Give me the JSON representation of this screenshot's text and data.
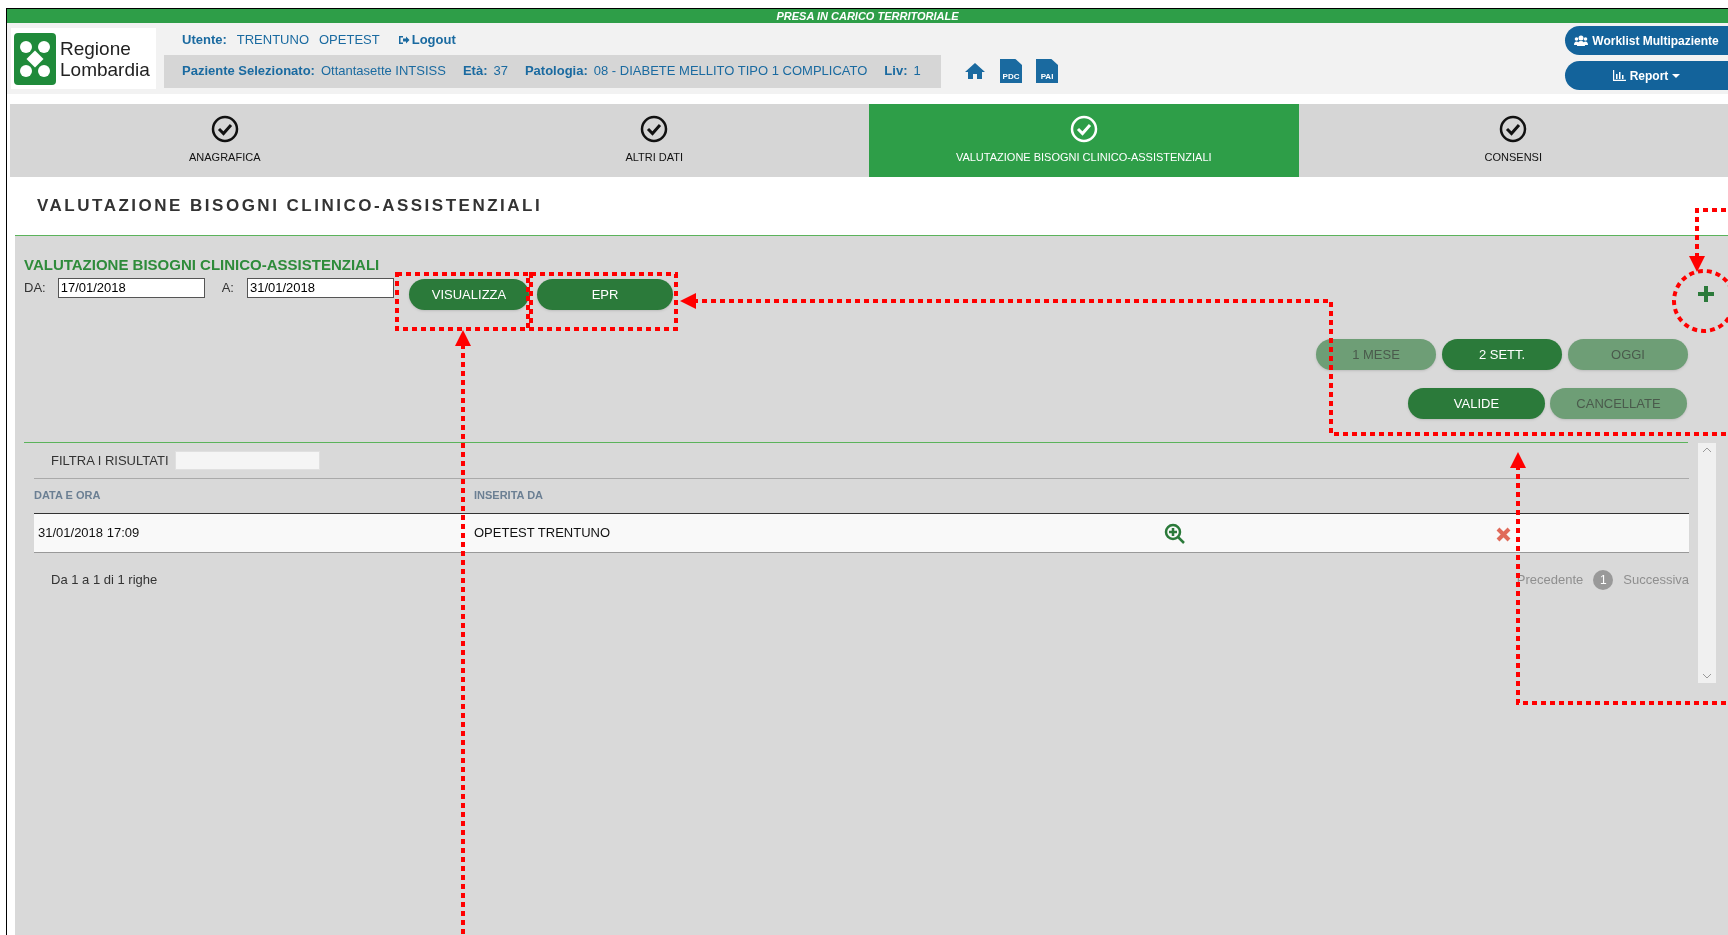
{
  "banner": "PRESA IN CARICO TERRITORIALE",
  "logo": {
    "line_1": "Regione",
    "line_2": "Lombardia"
  },
  "user": {
    "label": "Utente:",
    "values": [
      "TRENTUNO",
      "OPETEST"
    ],
    "logout": "Logout"
  },
  "patient_bar": [
    {
      "label": "Paziente Selezionato:",
      "value": "Ottantasette INTSISS"
    },
    {
      "label": "Età:",
      "value": "37"
    },
    {
      "label": "Patologia:",
      "value": "08 - DIABETE MELLITO TIPO 1 COMPLICATO"
    },
    {
      "label": "Liv:",
      "value": "1"
    }
  ],
  "header_icons": [
    {
      "kind": "home"
    },
    {
      "kind": "doc",
      "text": "PDC"
    },
    {
      "kind": "doc",
      "text": "PAI"
    }
  ],
  "header_buttons": [
    {
      "label": "Worklist Multipaziente",
      "kind": "users"
    },
    {
      "label": "Report",
      "kind": "chart"
    }
  ],
  "tabs": [
    {
      "label": "ANAGRAFICA",
      "selected": false
    },
    {
      "label": "ALTRI DATI",
      "selected": false
    },
    {
      "label": "VALUTAZIONE BISOGNI CLINICO-ASSISTENZIALI",
      "selected": true
    },
    {
      "label": "CONSENSI",
      "selected": false
    }
  ],
  "page_title": "VALUTAZIONE BISOGNI CLINICO-ASSISTENZIALI",
  "section_title": "VALUTAZIONE BISOGNI CLINICO-ASSISTENZIALI",
  "date_from": {
    "label": "DA:",
    "value": "17/01/2018"
  },
  "date_to": {
    "label": "A:",
    "value": "31/01/2018"
  },
  "actions": [
    "VISUALIZZA",
    "EPR"
  ],
  "ranges": [
    {
      "label": "1 MESE",
      "selected": false
    },
    {
      "label": "2 SETT.",
      "selected": true
    },
    {
      "label": "OGGI",
      "selected": false
    }
  ],
  "status_filters": [
    {
      "label": "VALIDE",
      "selected": true
    },
    {
      "label": "CANCELLATE",
      "selected": false
    }
  ],
  "filter": {
    "label": "FILTRA I RISULTATI"
  },
  "table": {
    "columns": [
      "DATA E ORA",
      "INSERITA DA"
    ],
    "rows": [
      {
        "cells": [
          "31/01/2018 17:09",
          "OPETEST TRENTUNO"
        ]
      }
    ]
  },
  "pagination": {
    "summary": "Da 1 a 1 di 1 righe",
    "previous": "Precedente",
    "page": "1",
    "next": "Successiva"
  }
}
